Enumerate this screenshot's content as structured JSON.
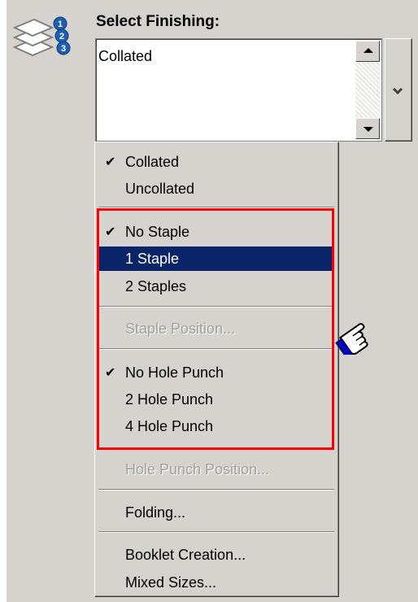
{
  "header": {
    "title": "Select Finishing:",
    "icon": "collated-pages-icon"
  },
  "listbox": {
    "value": "Collated"
  },
  "colors": {
    "panel_bg": "#d6d3ce",
    "highlight": "#0a246a",
    "annotation": "#ff0000",
    "hand_cuff": "#0000c0"
  },
  "menu": {
    "collation": [
      {
        "label": "Collated",
        "checked": true
      },
      {
        "label": "Uncollated",
        "checked": false
      }
    ],
    "stapling": [
      {
        "label": "No Staple",
        "checked": true
      },
      {
        "label": "1 Staple",
        "checked": false,
        "highlighted": true
      },
      {
        "label": "2 Staples",
        "checked": false
      }
    ],
    "staple_position": {
      "label": "Staple Position...",
      "disabled": true
    },
    "hole_punch": [
      {
        "label": "No Hole Punch",
        "checked": true
      },
      {
        "label": "2 Hole Punch",
        "checked": false
      },
      {
        "label": "4 Hole Punch",
        "checked": false
      }
    ],
    "hole_punch_position": {
      "label": "Hole Punch Position...",
      "disabled": true
    },
    "folding": {
      "label": "Folding..."
    },
    "booklet_creation": {
      "label": "Booklet Creation..."
    },
    "mixed_sizes": {
      "label": "Mixed Sizes..."
    },
    "check_glyph": "✔"
  }
}
